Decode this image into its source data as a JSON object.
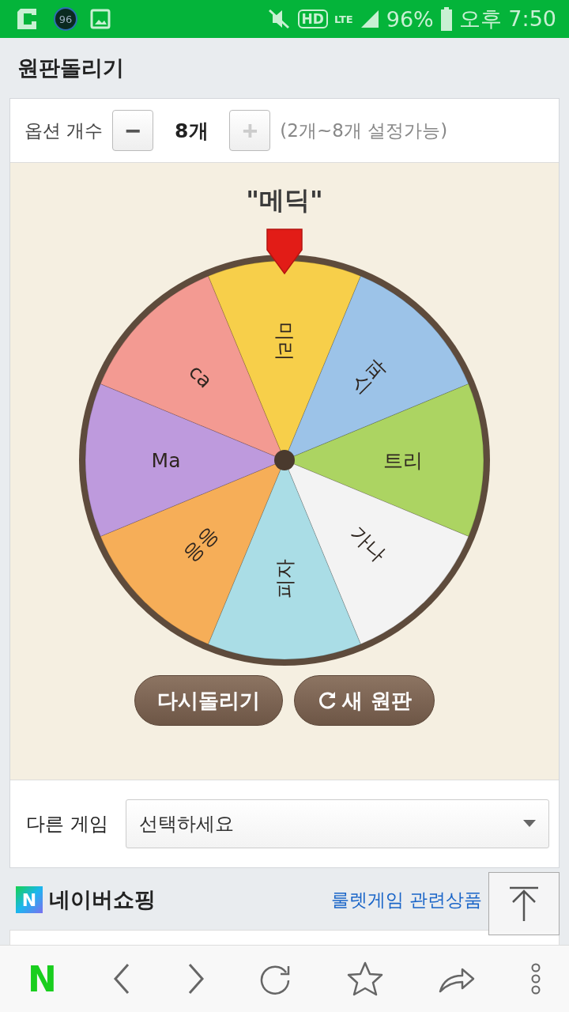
{
  "status_bar": {
    "badge": "96",
    "hd": "HD",
    "network": "LTE",
    "battery": "96%",
    "time": "오후 7:50"
  },
  "page_title": "원판돌리기",
  "options": {
    "label": "옵션 개수",
    "count": "8개",
    "decrease": "−",
    "increase": "+",
    "increase_disabled": true,
    "hint": "(2개~8개 설정가능)"
  },
  "result": "\"메딕\"",
  "wheel": {
    "segments": [
      {
        "label": "응응",
        "color": "#f6ae58"
      },
      {
        "label": "Ma",
        "color": "#be9add"
      },
      {
        "label": "ca",
        "color": "#f39a92"
      },
      {
        "label": "미리",
        "color": "#f7cf4a"
      },
      {
        "label": "스파",
        "color": "#9cc3e8"
      },
      {
        "label": "트리",
        "color": "#acd462"
      },
      {
        "label": "가나",
        "color": "#f3f3f3"
      },
      {
        "label": "피자",
        "color": "#aadde6"
      }
    ]
  },
  "buttons": [
    {
      "kind": "plain",
      "label": "다시돌리기"
    },
    {
      "kind": "refresh",
      "label": "새 원판"
    }
  ],
  "other_game": {
    "label": "다른 게임",
    "select": "선택하세요"
  },
  "shopping": {
    "logo": "N",
    "title": "네이버쇼핑",
    "link": "룰렛게임 관련상품"
  },
  "nav": {
    "logo": "N"
  }
}
